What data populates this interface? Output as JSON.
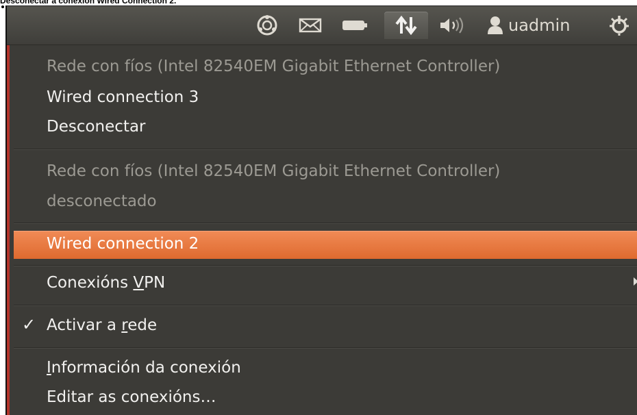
{
  "caption": "Desconectar a conexión Wired Connection 2.",
  "panel": {
    "indicators": [
      "ubuntu-one-icon",
      "mail-icon",
      "battery-icon",
      "network-updown-icon",
      "volume-icon",
      "user-icon",
      "power-icon"
    ],
    "username": "uadmin"
  },
  "menu": {
    "section1": {
      "device": "Rede con fíos (Intel 82540EM Gigabit Ethernet Controller)",
      "connection": "Wired connection 3",
      "action": "Desconectar"
    },
    "section2": {
      "device": "Rede con fíos (Intel 82540EM Gigabit Ethernet Controller)",
      "status": "desconectado"
    },
    "highlighted_item": "Wired connection 2",
    "vpn": {
      "before": "Conexións ",
      "mnemonic": "V",
      "after": "PN"
    },
    "enable_network": {
      "before": "Activar a ",
      "mnemonic": "r",
      "after": "ede",
      "checked": true
    },
    "connection_info": {
      "mnemonic": "I",
      "after": "nformación da conexión"
    },
    "edit_connections": "Editar as conexións…"
  },
  "colors": {
    "panel": "#4b4a45",
    "menu_bg": "#3c3b37",
    "highlight": "#e8743b",
    "text": "#f2f1ef",
    "disabled_text": "#9c9a93",
    "accent": "#b3342b"
  }
}
